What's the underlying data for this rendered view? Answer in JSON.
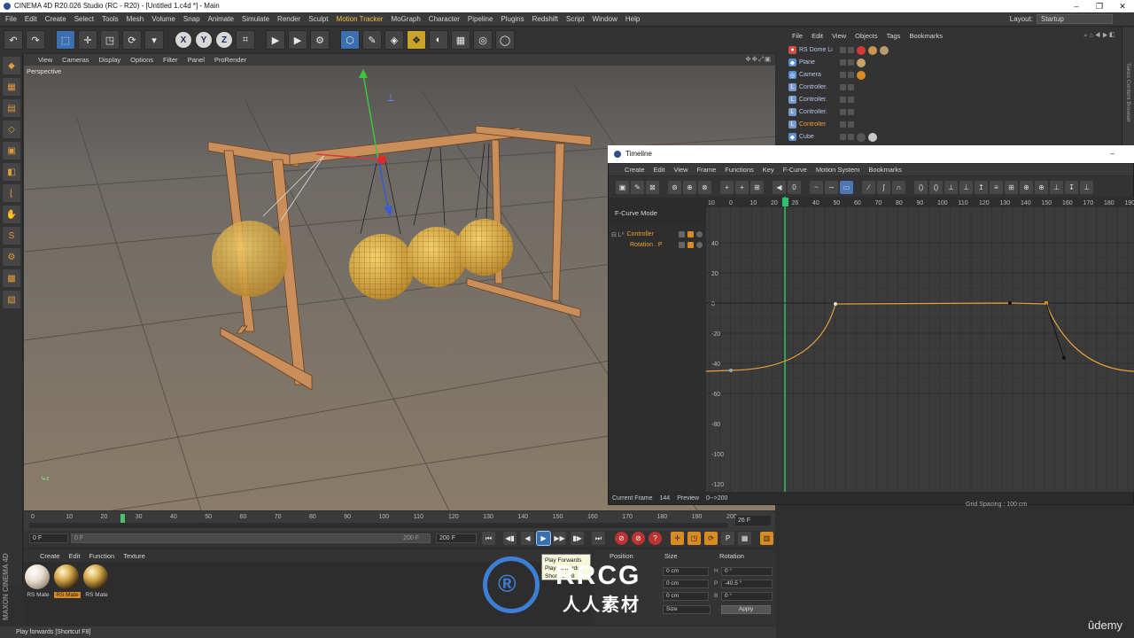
{
  "window": {
    "title": "CINEMA 4D R20.026 Studio (RC - R20) - [Untitled 1.c4d *] - Main",
    "buttons": [
      "–",
      "❐",
      "✕"
    ]
  },
  "menubar": {
    "items": [
      "File",
      "Edit",
      "Create",
      "Select",
      "Tools",
      "Mesh",
      "Volume",
      "Snap",
      "Animate",
      "Simulate",
      "Render",
      "Sculpt",
      "Motion Tracker",
      "MoGraph",
      "Character",
      "Pipeline",
      "Plugins",
      "Redshift",
      "Script",
      "Window",
      "Help"
    ],
    "layout_label": "Layout:",
    "layout_value": "Startup"
  },
  "toolbar": {
    "icons": [
      "undo-icon",
      "redo-icon",
      "live-select-icon",
      "move-icon",
      "scale-icon",
      "rotate-icon",
      "recent-tools-icon",
      "x-axis-icon",
      "y-axis-icon",
      "z-axis-icon",
      "coordinate-system-icon",
      "render-view-icon",
      "render-picture-viewer-icon",
      "edit-render-settings-icon",
      "cube-icon",
      "pen-icon",
      "subdivision-icon",
      "cloner-icon",
      "deformer-icon",
      "floor-icon",
      "camera-icon",
      "light-icon"
    ],
    "glyphs": [
      "↶",
      "↷",
      "⬚",
      "✛",
      "◳",
      "⟳",
      "▾",
      "X",
      "Y",
      "Z",
      "⌗",
      "▶",
      "▶",
      "⚙",
      "⬡",
      "✎",
      "◈",
      "❖",
      "◐",
      "▦",
      "◎",
      "◯"
    ],
    "axes": [
      "X",
      "Y",
      "Z"
    ]
  },
  "left_tools": [
    "◆",
    "▦",
    "▤",
    "◇",
    "▣",
    "◧",
    "⌊",
    "✋",
    "S",
    "⚙",
    "▩",
    "▧"
  ],
  "viewport": {
    "menu": [
      "View",
      "Cameras",
      "Display",
      "Options",
      "Filter",
      "Panel",
      "ProRender"
    ],
    "nav_icons": "✥✥⤢▣",
    "label": "Perspective",
    "axis_glyph": "↳z"
  },
  "object_manager": {
    "tabs": [
      "File",
      "Edit",
      "View",
      "Objects",
      "Tags",
      "Bookmarks"
    ],
    "nav_icons": "⌕ ⌂ ◀ ▶ ◧",
    "rows": [
      {
        "name": "RS Dome Li",
        "icon_color": "#d24a4a",
        "glyph": "●",
        "tags": [
          "#d43a3a",
          "#c89650",
          "#b89a70"
        ]
      },
      {
        "name": "Plane",
        "icon_color": "#5a8fd0",
        "glyph": "◆",
        "tags": [
          "#c9a46a"
        ]
      },
      {
        "name": "Camera",
        "icon_color": "#5a8fd0",
        "glyph": "◎",
        "tags": [
          "#d88b20"
        ]
      },
      {
        "name": "Controller.",
        "icon_color": "#7a9ad0",
        "glyph": "L",
        "tags": []
      },
      {
        "name": "Controller.",
        "icon_color": "#7a9ad0",
        "glyph": "L",
        "tags": []
      },
      {
        "name": "Controller.",
        "icon_color": "#7a9ad0",
        "glyph": "L",
        "tags": []
      },
      {
        "name": "Controller",
        "icon_color": "#7a9ad0",
        "glyph": "L",
        "tags": []
      },
      {
        "name": "Cube",
        "icon_color": "#5a8fd0",
        "glyph": "◆",
        "tags": [
          "#555555",
          "#c9c9c9"
        ]
      }
    ],
    "side_tabs": "Takes   Content Browser"
  },
  "timeline": {
    "title": "Timeline",
    "min_button": "–",
    "menu": [
      "Create",
      "Edit",
      "View",
      "Frame",
      "Functions",
      "Key",
      "F-Curve",
      "Motion System",
      "Bookmarks"
    ],
    "tool_glyphs": [
      "▣",
      "✎",
      "⊠",
      "⊚",
      "⊕",
      "⊗",
      "+",
      "+",
      "⊞",
      "◀",
      "0",
      "~",
      "∼",
      "▭",
      "∕",
      "∫",
      "∩",
      "()",
      "()",
      "⊥",
      "⊥",
      "↥",
      "≡",
      "⊞",
      "⊕",
      "⊕",
      "⊥",
      "↧",
      "⊥"
    ],
    "mode_label": "F-Curve Mode",
    "tracks": [
      {
        "name": "Controller",
        "indent": 0,
        "glyph": "⊟ L⁰"
      },
      {
        "name": "Rotation . P",
        "indent": 1,
        "glyph": ""
      }
    ],
    "ruler_labels": [
      "10",
      "0",
      "10",
      "20",
      "26",
      "40",
      "50",
      "60",
      "70",
      "80",
      "90",
      "100",
      "110",
      "120",
      "130",
      "140",
      "150",
      "160",
      "170",
      "180",
      "190"
    ],
    "y_labels": [
      "40",
      "20",
      "0",
      "-20",
      "-40",
      "-60",
      "-80",
      "-100",
      "-120"
    ],
    "current_frame_label": "Current Frame",
    "current_frame": "144",
    "preview_label": "Preview",
    "preview_range": "0-->200",
    "grid_spacing": "Grid Spacing : 100 cm",
    "colors": {
      "curve": "#e8a33a",
      "playhead": "#30c070",
      "key": "#d88b20"
    }
  },
  "time_ruler": {
    "ticks": [
      "0",
      "10",
      "20",
      "30",
      "40",
      "50",
      "60",
      "70",
      "80",
      "90",
      "100",
      "110",
      "120",
      "130",
      "140",
      "150",
      "160",
      "170",
      "180",
      "190",
      "200"
    ],
    "current_frame_field": "26 F"
  },
  "playback": {
    "start_field": "0 F",
    "range_start": "0 F",
    "range_end": "200 F",
    "end_field": "200 F",
    "buttons": [
      "⏮",
      "◀▮",
      "◀",
      "▶▶",
      "▶",
      "▮▶",
      "⏭"
    ],
    "record_buttons": [
      "⊘",
      "⊘",
      "?"
    ],
    "key_buttons": [
      "✛",
      "◳",
      "⟳",
      "P",
      "▦"
    ],
    "end_button": "▥"
  },
  "tooltip": {
    "title": "Play Forwards",
    "line2": "Play forwards",
    "line3": "Shortcut F8"
  },
  "material_manager": {
    "menu": [
      "Create",
      "Edit",
      "Function",
      "Texture"
    ],
    "materials": [
      {
        "name": "RS Mate",
        "selected": false,
        "color": "#e8dccf"
      },
      {
        "name": "RS Mate",
        "selected": true,
        "color": "#d4a84a"
      },
      {
        "name": "RS Mate",
        "selected": false,
        "color": "#d4a84a"
      }
    ]
  },
  "coordinates": {
    "headers": [
      "Position",
      "Size",
      "Rotation"
    ],
    "size_fields": [
      "0 cm",
      "0 cm",
      "0 cm"
    ],
    "rot_labels": [
      "H",
      "P",
      "B"
    ],
    "rot_fields": [
      "0 °",
      "-40.5 °",
      "0 °"
    ],
    "mode_select": "Size",
    "apply_label": "Apply"
  },
  "brand": {
    "maxon": "MAXON CINEMA 4D",
    "udemy": "ûdemy"
  },
  "status": {
    "text": "Play forwards [Shortcut F8]"
  },
  "watermark": {
    "logo_text": "RRCG",
    "cn_text": "人人素材",
    "circle_glyph": "®",
    "top_text": "RRCG.cn"
  }
}
